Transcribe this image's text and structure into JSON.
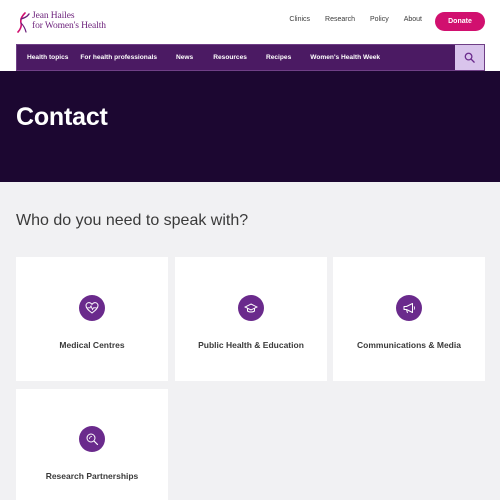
{
  "brand": {
    "line1": "Jean Hailes",
    "line2": "for Women's Health",
    "color": "#6b1f7a"
  },
  "utility_nav": [
    "Clinics",
    "Research",
    "Policy",
    "About"
  ],
  "donate_label": "Donate",
  "main_nav": [
    "Health topics",
    "For health professionals",
    "News",
    "Resources",
    "Recipes",
    "Women's Health Week"
  ],
  "search_icon": "search-icon",
  "hero": {
    "title": "Contact"
  },
  "section": {
    "title": "Who do you need to speak with?"
  },
  "cards": [
    {
      "label": "Medical Centres",
      "icon": "heart-pulse-icon"
    },
    {
      "label": "Public Health & Education",
      "icon": "graduation-cap-icon"
    },
    {
      "label": "Communications & Media",
      "icon": "megaphone-icon"
    },
    {
      "label": "Research Partnerships",
      "icon": "research-icon"
    }
  ],
  "colors": {
    "accent_pink": "#d1106f",
    "nav_purple": "#4b1a63",
    "hero_dark": "#1c0731",
    "icon_purple": "#6a2a8c",
    "search_bg": "#d9c4ec"
  }
}
